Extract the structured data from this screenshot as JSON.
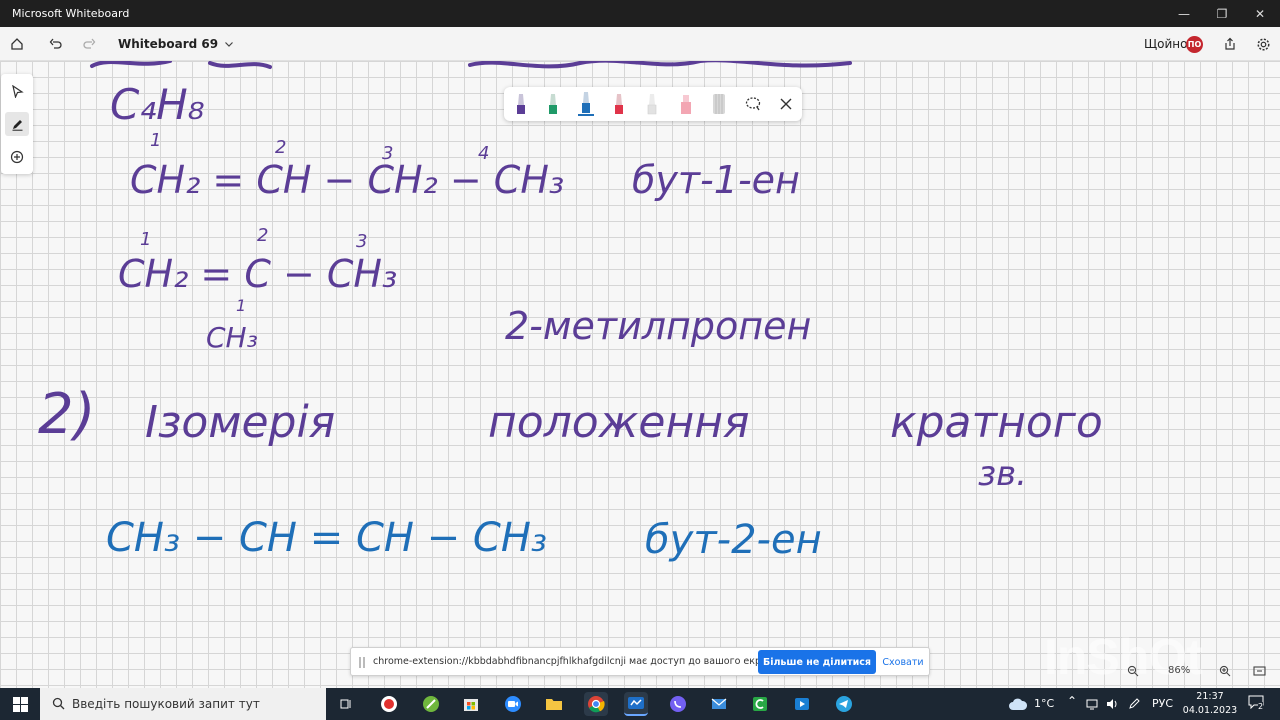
{
  "window": {
    "title": "Microsoft Whiteboard",
    "minimize_glyph": "—",
    "maximize_glyph": "❐",
    "close_glyph": "✕"
  },
  "appbar": {
    "board_title": "Whiteboard 69",
    "user_name": "Щойно",
    "avatar_initials": "ПО",
    "icons": [
      "home-icon",
      "undo-icon",
      "redo-icon",
      "chevron-down-icon",
      "share-icon",
      "settings-icon"
    ]
  },
  "tools": {
    "left": [
      "select-icon",
      "pen-icon",
      "add-icon"
    ],
    "pens": [
      {
        "name": "purple-pen",
        "color": "#5b3d96"
      },
      {
        "name": "green-pen",
        "color": "#1f9a68"
      },
      {
        "name": "blue-pen",
        "color": "#1f6fb8"
      },
      {
        "name": "red-pen",
        "color": "#e0344a"
      },
      {
        "name": "white-pen",
        "color": "#e8e8e8"
      },
      {
        "name": "pink-highlighter",
        "color": "#f3a6b3"
      },
      {
        "name": "eraser",
        "color": "#cfcfcf"
      }
    ]
  },
  "board": {
    "handwriting": {
      "formula_c4h8": "C₄H₈",
      "locants_line1": [
        "1",
        "2",
        "3",
        "4"
      ],
      "formula_1": "CH₂ = CH − CH₂ − CH₃",
      "name_1": "бут-1-ен",
      "locants_line2": [
        "1",
        "2",
        "3"
      ],
      "formula_2": "CH₂ = C − CH₃",
      "branch": "CH₃",
      "branch_locant": "1",
      "name_2": "2-метилпропен",
      "item_number": "2)",
      "heading_word1": "Ізомерія",
      "heading_word2": "положення",
      "heading_word3": "кратного",
      "heading_word4": "зв.",
      "formula_3": "CH₃ − CH = CH − CH₃",
      "name_3": "бут-2-ен"
    },
    "ink_colors": {
      "purple": "#5b3d96",
      "blue": "#1f6fb8"
    }
  },
  "share_notice": {
    "message": "chrome-extension://kbbdabhdfibnancpjfhlkhafgdilcnji має доступ до вашого екрана.",
    "stop_label": "Більше не ділитися",
    "hide_label": "Сховати"
  },
  "zoom": {
    "level": "86%"
  },
  "watermark": "InShOt",
  "taskbar": {
    "search_placeholder": "Введіть пошуковий запит тут",
    "weather": "1°C",
    "language": "РУС",
    "time": "21:37",
    "date": "04.01.2023",
    "notification_count": "2"
  }
}
